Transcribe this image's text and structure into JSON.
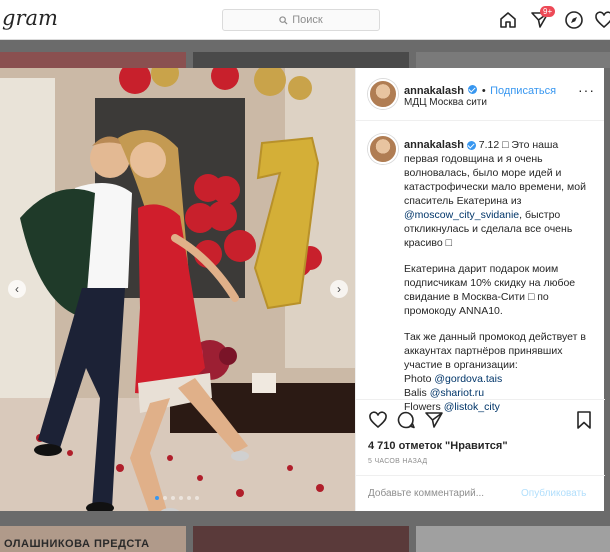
{
  "topbar": {
    "logo": "gram",
    "search_placeholder": "Поиск",
    "notification_badge": "9+"
  },
  "background": {
    "thumb_caption": "ОЛАШНИКОВА ПРЕДСТА"
  },
  "post": {
    "username": "annakalash",
    "follow_label": "Подписаться",
    "location": "МДЦ Москва сити",
    "caption_paragraphs": [
      "7.12 □ Это наша первая годовщина и я очень волновалась, было море идей и катастрофически мало времени, мой спаситель Екатерина из",
      "Екатерина дарит подарок моим подписчикам 10% скидку на любое свидание в Москва-Сити □ по промокоду ANNA10.",
      "Так же данный промокод действует в аккаунтах партнёров принявших участие в организации:"
    ],
    "caption_mention_1": "@moscow_city_svidanie",
    "caption_tail_1": ", быстро откликнулась и сделала все очень красиво □",
    "partners": [
      {
        "label": "Photo ",
        "handle": "@gordova.tais"
      },
      {
        "label": "Balis ",
        "handle": "@shariot.ru"
      },
      {
        "label": "Flowers ",
        "handle": "@listok_city"
      }
    ],
    "likes": "4 710 отметок \"Нравится\"",
    "time": "5 ЧАСОВ НАЗАД",
    "comment_placeholder": "Добавьте комментарий...",
    "publish_label": "Опубликовать",
    "slides_total": 6,
    "slide_active": 1
  },
  "colors": {
    "accent": "#3897f0",
    "badge": "#ed4956",
    "balloon": "#d4af37"
  }
}
